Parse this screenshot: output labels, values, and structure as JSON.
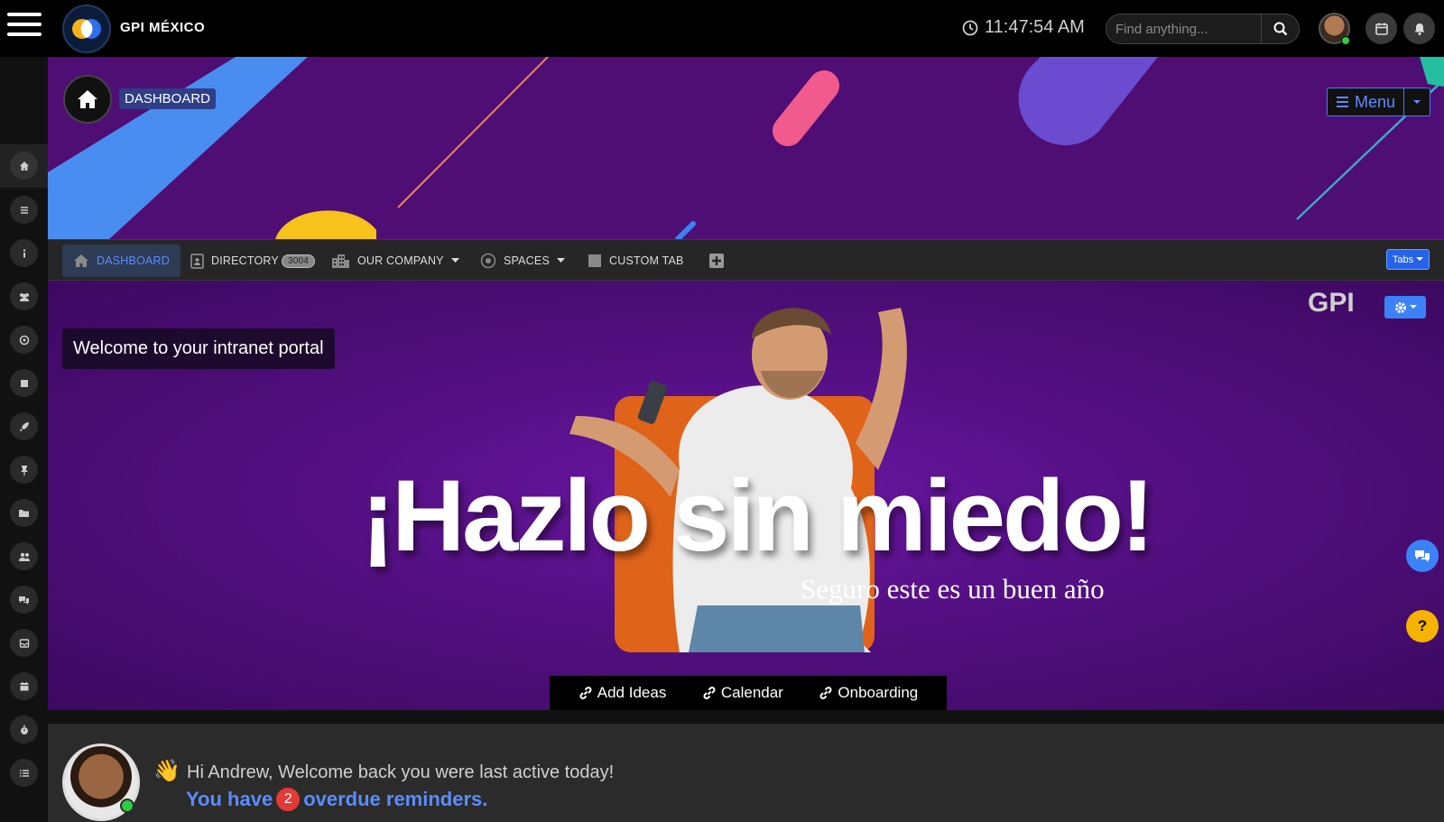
{
  "header": {
    "app_title": "GPI MÉXICO",
    "clock": "11:47:54 AM",
    "search_placeholder": "Find anything...",
    "icons": [
      "menu-icon",
      "search-icon",
      "calendar-icon",
      "bell-icon",
      "clock-icon"
    ]
  },
  "sidebar": {
    "icons": [
      "home-icon",
      "list-icon",
      "info-icon",
      "users-icon",
      "support-icon",
      "stop-icon",
      "rocket-icon",
      "pin-icon",
      "folder-icon",
      "group-icon",
      "chat-icon",
      "inbox-icon",
      "calendar-icon",
      "stopwatch-icon",
      "ordered-list-icon"
    ]
  },
  "banner": {
    "page_label": "DASHBOARD",
    "menu_label": "Menu"
  },
  "tabs": {
    "items": [
      {
        "label": "DASHBOARD",
        "icon": "home-icon",
        "active": true
      },
      {
        "label": "DIRECTORY",
        "icon": "contact-card-icon",
        "badge": "3004"
      },
      {
        "label": "OUR COMPANY",
        "icon": "building-icon",
        "dropdown": true
      },
      {
        "label": "SPACES",
        "icon": "target-icon",
        "dropdown": true
      },
      {
        "label": "CUSTOM TAB",
        "icon": "square-icon"
      }
    ],
    "add_tab_icon": "plus-square-icon",
    "tabs_button": "Tabs"
  },
  "hero": {
    "welcome": "Welcome to your intranet portal",
    "title": "¡Hazlo sin miedo!",
    "subtitle": "Seguro este es un buen año",
    "brand_mark": "GPI",
    "quick_links": [
      "Add Ideas",
      "Calendar",
      "Onboarding"
    ]
  },
  "welcome_panel": {
    "greeting": "Hi Andrew, Welcome back you were last active today!",
    "reminder_prefix": "You have",
    "reminder_count": "2",
    "reminder_suffix": "overdue reminders."
  },
  "colors": {
    "accent": "#3b82f6",
    "banner_purple": "#4e0e74",
    "orange": "#e0631a",
    "help": "#f5b300"
  }
}
